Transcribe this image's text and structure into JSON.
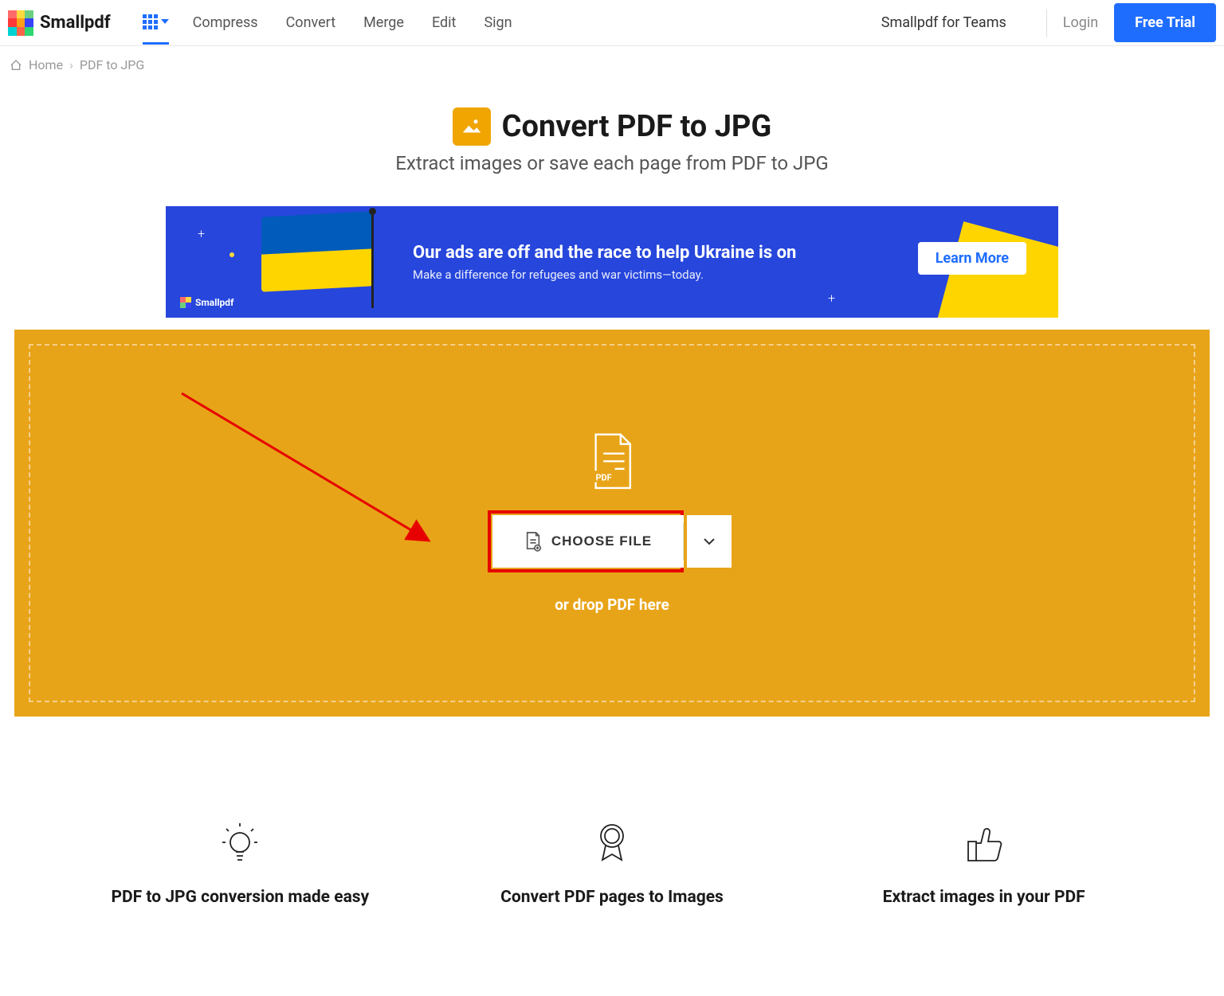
{
  "brand": "Smallpdf",
  "nav": {
    "compress": "Compress",
    "convert": "Convert",
    "merge": "Merge",
    "edit": "Edit",
    "sign": "Sign"
  },
  "header": {
    "teams": "Smallpdf for Teams",
    "login": "Login",
    "trial": "Free Trial"
  },
  "breadcrumb": {
    "home": "Home",
    "current": "PDF to JPG"
  },
  "title": "Convert PDF to JPG",
  "subtitle": "Extract images or save each page from PDF to JPG",
  "banner": {
    "title": "Our ads are off and the race to help Ukraine is on",
    "sub": "Make a difference for refugees and war victims—today.",
    "cta": "Learn More",
    "logo": "Smallpdf"
  },
  "drop": {
    "pdf_badge": "PDF",
    "choose": "CHOOSE FILE",
    "hint": "or drop PDF here"
  },
  "features": {
    "f1": "PDF to JPG conversion made easy",
    "f2": "Convert PDF pages to Images",
    "f3": "Extract images in your PDF"
  }
}
